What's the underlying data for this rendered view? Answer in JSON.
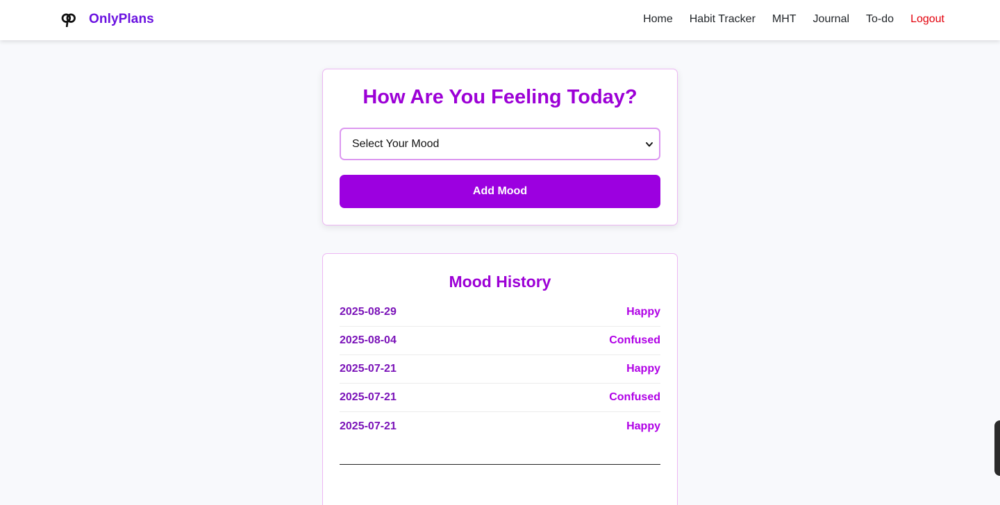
{
  "brand": {
    "name": "OnlyPlans",
    "logo_icon": "onlyplans-logo-icon",
    "color": "#6a11e0"
  },
  "nav": {
    "links": [
      {
        "label": "Home"
      },
      {
        "label": "Habit Tracker"
      },
      {
        "label": "MHT"
      },
      {
        "label": "Journal"
      },
      {
        "label": "To-do"
      },
      {
        "label": "Logout"
      }
    ]
  },
  "mood_form": {
    "title": "How Are You Feeling Today?",
    "select_value": "Select Your Mood",
    "submit_label": "Add Mood",
    "accent_color": "#9c00e0"
  },
  "history": {
    "title": "Mood History",
    "entries": [
      {
        "date": "2025-08-29",
        "mood": "Happy"
      },
      {
        "date": "2025-08-04",
        "mood": "Confused"
      },
      {
        "date": "2025-07-21",
        "mood": "Happy"
      },
      {
        "date": "2025-07-21",
        "mood": "Confused"
      },
      {
        "date": "2025-07-21",
        "mood": "Happy"
      }
    ]
  }
}
